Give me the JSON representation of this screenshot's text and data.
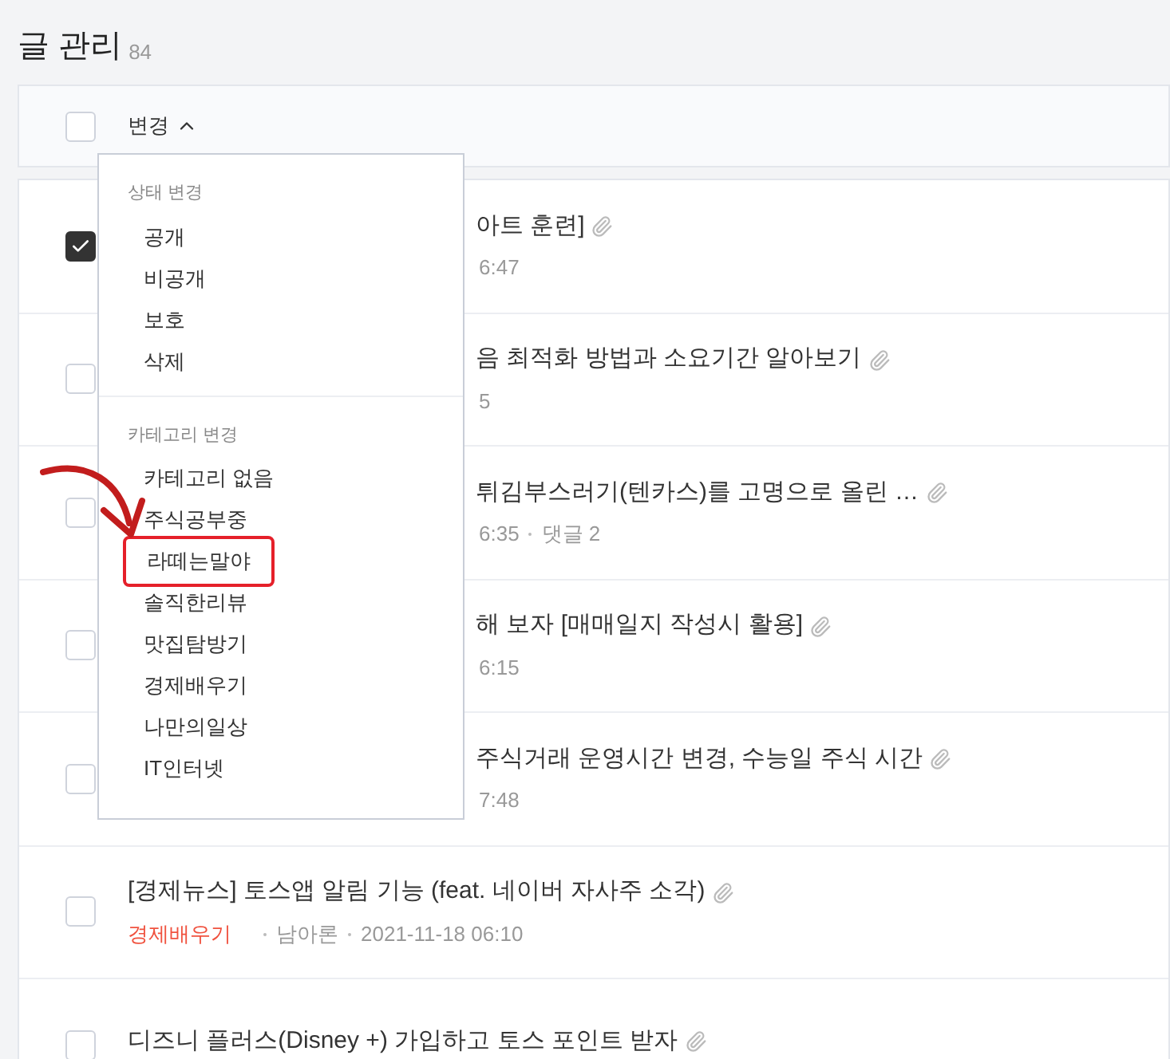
{
  "page": {
    "title": "글 관리",
    "count": "84"
  },
  "toolbar": {
    "checked": false,
    "change_button": "변경",
    "expanded": true
  },
  "dropdown": {
    "sections": [
      {
        "label": "상태 변경",
        "items": [
          {
            "label": "공개",
            "highlighted": false
          },
          {
            "label": "비공개",
            "highlighted": false
          },
          {
            "label": "보호",
            "highlighted": false
          },
          {
            "label": "삭제",
            "highlighted": false
          }
        ]
      },
      {
        "label": "카테고리 변경",
        "items": [
          {
            "label": "카테고리 없음",
            "highlighted": false
          },
          {
            "label": "주식공부중",
            "highlighted": false
          },
          {
            "label": "라떼는말야",
            "highlighted": true
          },
          {
            "label": "솔직한리뷰",
            "highlighted": false
          },
          {
            "label": "맛집탐방기",
            "highlighted": false
          },
          {
            "label": "경제배우기",
            "highlighted": false
          },
          {
            "label": "나만의일상",
            "highlighted": false
          },
          {
            "label": "IT인터넷",
            "highlighted": false
          }
        ]
      }
    ]
  },
  "posts": [
    {
      "checked": true,
      "partly_hidden": true,
      "title": "아트 훈련]",
      "attachment": true,
      "meta": [
        "6:47"
      ]
    },
    {
      "checked": false,
      "partly_hidden": true,
      "title": "음 최적화 방법과 소요기간 알아보기",
      "attachment": true,
      "meta": [
        "5"
      ]
    },
    {
      "checked": false,
      "partly_hidden": true,
      "title": "튀김부스러기(텐카스)를 고명으로 올린 …",
      "attachment": true,
      "meta": [
        "6:35",
        "댓글 2"
      ]
    },
    {
      "checked": false,
      "partly_hidden": true,
      "title": "해 보자 [매매일지 작성시 활용]",
      "attachment": true,
      "meta": [
        "6:15"
      ]
    },
    {
      "checked": false,
      "partly_hidden": true,
      "title": "주식거래 운영시간 변경, 수능일 주식 시간",
      "attachment": true,
      "meta": [
        "7:48"
      ]
    },
    {
      "checked": false,
      "partly_hidden": false,
      "title": "[경제뉴스] 토스앱 알림 기능 (feat. 네이버 자사주 소각)",
      "attachment": true,
      "category": "경제배우기",
      "meta": [
        "남아론",
        "2021-11-18 06:10"
      ]
    },
    {
      "checked": false,
      "partly_hidden": false,
      "title": "디즈니 플러스(Disney +) 가입하고 토스 포인트 받자",
      "attachment": true
    }
  ]
}
